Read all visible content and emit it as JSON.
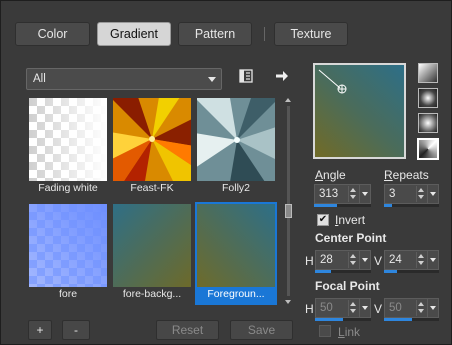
{
  "tabs": [
    {
      "label": "Color"
    },
    {
      "label": "Gradient"
    },
    {
      "label": "Pattern"
    },
    {
      "label": "Texture"
    }
  ],
  "category": {
    "selected": "All"
  },
  "gradients": [
    {
      "name": "Fading white"
    },
    {
      "name": "Feast-FK"
    },
    {
      "name": "Folly2"
    },
    {
      "name": "fore"
    },
    {
      "name": "fore-backg..."
    },
    {
      "name": "Foregroun..."
    }
  ],
  "buttons": {
    "add": "+",
    "remove": "-",
    "reset": "Reset",
    "save": "Save"
  },
  "angle": {
    "label_prefix": "A",
    "label_rest": "ngle",
    "value": "313"
  },
  "repeats": {
    "label_prefix": "R",
    "label_rest": "epeats",
    "value": "3"
  },
  "invert": {
    "label_prefix": "I",
    "label_rest": "nvert",
    "checked": true
  },
  "center_point": {
    "label": "Center Point",
    "h_label": "H",
    "h_value": "28",
    "v_label": "V",
    "v_value": "24"
  },
  "focal_point": {
    "label": "Focal Point",
    "h_label": "H",
    "h_value": "50",
    "v_label": "V",
    "v_value": "50"
  },
  "link": {
    "label_prefix": "L",
    "label_rest": "ink",
    "checked": false
  },
  "colors": {
    "accent": "#2e86de",
    "selection": "#1a77d6",
    "fg_teal": "#2f6f86",
    "fg_olive": "#6d6a2a"
  }
}
